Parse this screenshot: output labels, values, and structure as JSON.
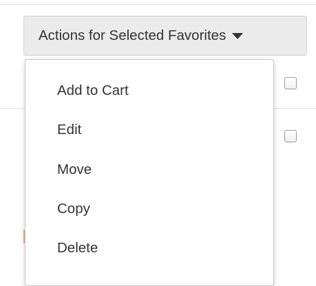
{
  "toolbar": {
    "actions_label": "Actions for Selected Favorites"
  },
  "dropdown": {
    "items": [
      {
        "label": "Add to Cart"
      },
      {
        "label": "Edit"
      },
      {
        "label": "Move"
      },
      {
        "label": "Copy"
      },
      {
        "label": "Delete"
      }
    ]
  },
  "icons": {
    "caret": "caret-down-icon"
  }
}
